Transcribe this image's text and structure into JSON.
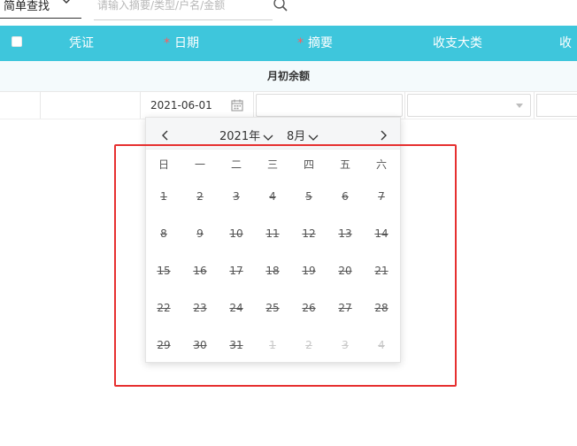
{
  "search": {
    "type_label": "简单查找",
    "placeholder": "请输入摘要/类型/户名/金额"
  },
  "table": {
    "headers": [
      "凭证",
      "日期",
      "摘要",
      "收支大类",
      "收"
    ],
    "balance_label": "月初余额",
    "date_value": "2021-06-01"
  },
  "calendar": {
    "year_label": "2021年",
    "month_label": "8月",
    "weekdays": [
      "日",
      "一",
      "二",
      "三",
      "四",
      "五",
      "六"
    ],
    "weeks": [
      [
        {
          "d": "1"
        },
        {
          "d": "2"
        },
        {
          "d": "3"
        },
        {
          "d": "4"
        },
        {
          "d": "5"
        },
        {
          "d": "6"
        },
        {
          "d": "7"
        }
      ],
      [
        {
          "d": "8"
        },
        {
          "d": "9"
        },
        {
          "d": "10"
        },
        {
          "d": "11"
        },
        {
          "d": "12"
        },
        {
          "d": "13"
        },
        {
          "d": "14"
        }
      ],
      [
        {
          "d": "15"
        },
        {
          "d": "16"
        },
        {
          "d": "17"
        },
        {
          "d": "18"
        },
        {
          "d": "19"
        },
        {
          "d": "20"
        },
        {
          "d": "21"
        }
      ],
      [
        {
          "d": "22"
        },
        {
          "d": "23"
        },
        {
          "d": "24"
        },
        {
          "d": "25"
        },
        {
          "d": "26"
        },
        {
          "d": "27"
        },
        {
          "d": "28"
        }
      ],
      [
        {
          "d": "29"
        },
        {
          "d": "30"
        },
        {
          "d": "31"
        },
        {
          "d": "1",
          "other": true
        },
        {
          "d": "2",
          "other": true
        },
        {
          "d": "3",
          "other": true
        },
        {
          "d": "4",
          "other": true
        }
      ]
    ]
  },
  "colors": {
    "header_bg": "#3ec6dc",
    "required_star": "#ff5c5c",
    "highlight_border": "#e63030"
  },
  "icons": [
    "chevron-down-icon",
    "search-icon",
    "checkbox-icon",
    "calendar-icon",
    "chevron-left-icon",
    "chevron-right-icon",
    "caret-down-icon"
  ]
}
